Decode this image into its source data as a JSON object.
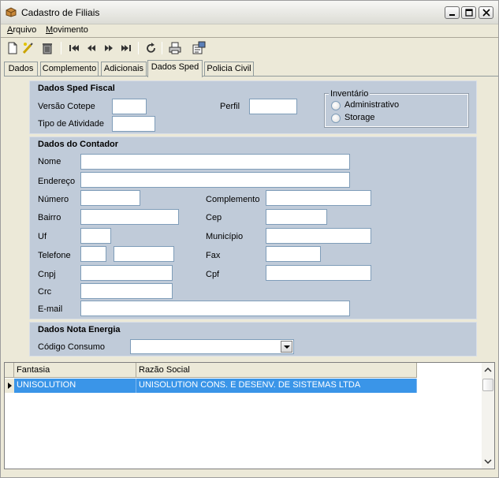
{
  "window": {
    "title": "Cadastro de Filiais"
  },
  "menu": {
    "items": [
      {
        "accel": "A",
        "rest": "rquivo"
      },
      {
        "accel": "M",
        "rest": "ovimento"
      }
    ]
  },
  "toolbar": {
    "buttons": [
      "new-icon",
      "edit-icon",
      "delete-icon",
      "first-icon",
      "prev-icon",
      "next-icon",
      "last-icon",
      "refresh-icon",
      "print-icon",
      "properties-icon"
    ]
  },
  "tabs": [
    "Dados",
    "Complemento",
    "Adicionais",
    "Dados Sped",
    "Policia Civil"
  ],
  "active_tab": "Dados Sped",
  "sped": {
    "title": "Dados Sped Fiscal",
    "versao_label": "Versão  Cotepe",
    "versao_value": "",
    "perfil_label": "Perfil",
    "perfil_value": "",
    "tipo_label": "Tipo de Atividade",
    "tipo_value": "",
    "inventario": {
      "legend": "Inventário",
      "opt1": "Administrativo",
      "opt2": "Storage"
    }
  },
  "contador": {
    "title": "Dados do Contador",
    "nome": "Nome",
    "endereco": "Endereço",
    "numero": "Número",
    "complemento": "Complemento",
    "bairro": "Bairro",
    "cep": "Cep",
    "uf": "Uf",
    "municipio": "Município",
    "telefone": "Telefone",
    "fax": "Fax",
    "cnpj": "Cnpj",
    "cpf": "Cpf",
    "crc": "Crc",
    "email": "E-mail"
  },
  "energia": {
    "title": "Dados Nota Energia",
    "codigo_label": "Código Consumo",
    "codigo_value": ""
  },
  "grid": {
    "columns": [
      "Fantasia",
      "Razão Social"
    ],
    "rows": [
      [
        "UNISOLUTION",
        "UNISOLUTION CONS. E DESENV. DE SISTEMAS LTDA"
      ]
    ]
  },
  "colors": {
    "panel": "#c0cbd9",
    "selection": "#3a95e8"
  }
}
